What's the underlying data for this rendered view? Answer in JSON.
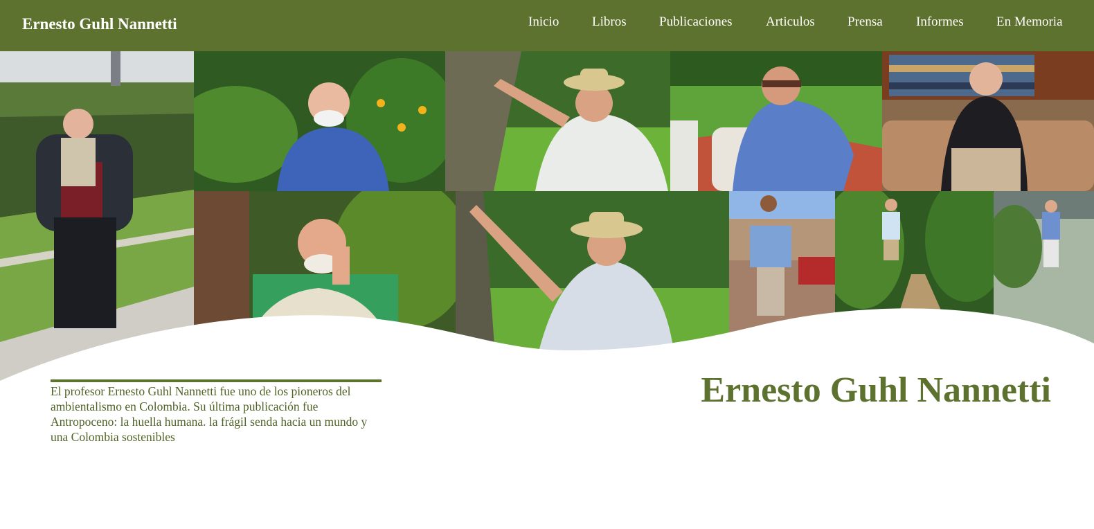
{
  "header": {
    "site_title": "Ernesto Guhl Nannetti",
    "nav": [
      "Inicio",
      "Libros",
      "Publicaciones",
      "Articulos",
      "Prensa",
      "Informes",
      "En Memoria"
    ]
  },
  "hero": {
    "photo_count": 11
  },
  "main": {
    "intro_text": "El profesor Ernesto Guhl Nannetti fue uno de los pioneros del ambientalismo en Colombia. Su última publicación fue Antropoceno: la huella humana. la frágil senda hacia un mundo y una Colombia sostenibles",
    "headline": "Ernesto Guhl Nannetti"
  },
  "colors": {
    "brand_green": "#5e722f",
    "text_green": "#4f6325",
    "white": "#ffffff"
  }
}
